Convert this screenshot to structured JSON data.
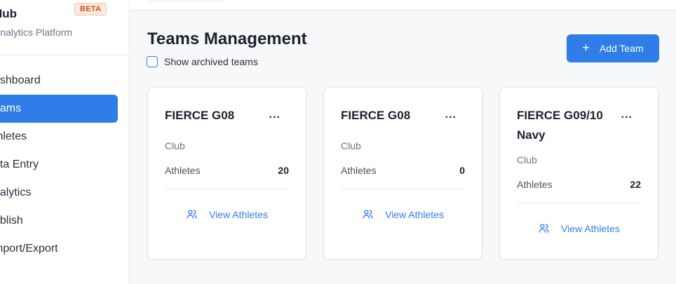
{
  "sidebar": {
    "brand_name": "Hub",
    "brand_sub": "Analytics Platform",
    "badge": "BETA",
    "items": [
      {
        "label": "ashboard"
      },
      {
        "label": "eams"
      },
      {
        "label": "thletes"
      },
      {
        "label": "ata Entry"
      },
      {
        "label": "nalytics"
      },
      {
        "label": "ublish"
      },
      {
        "label": "mport/Export"
      }
    ]
  },
  "main": {
    "title": "Teams Management",
    "archived_label": "Show archived teams",
    "add_team_label": "Add Team",
    "cards": [
      {
        "title": "FIERCE G08",
        "type": "Club",
        "athletes_label": "Athletes",
        "athletes_count": "20",
        "menu": "...",
        "view_label": "View Athletes"
      },
      {
        "title": "FIERCE G08",
        "type": "Club",
        "athletes_label": "Athletes",
        "athletes_count": "0",
        "menu": "...",
        "view_label": "View Athletes"
      },
      {
        "title": "FIERCE G09/10 Navy",
        "type": "Club",
        "athletes_label": "Athletes",
        "athletes_count": "22",
        "menu": "...",
        "view_label": "View Athletes"
      }
    ]
  },
  "colors": {
    "accent": "#2f7de9",
    "badge_bg": "#fde9e0",
    "badge_text": "#c75423"
  },
  "icons": {
    "plus": "plus-icon",
    "users": "users-icon"
  }
}
